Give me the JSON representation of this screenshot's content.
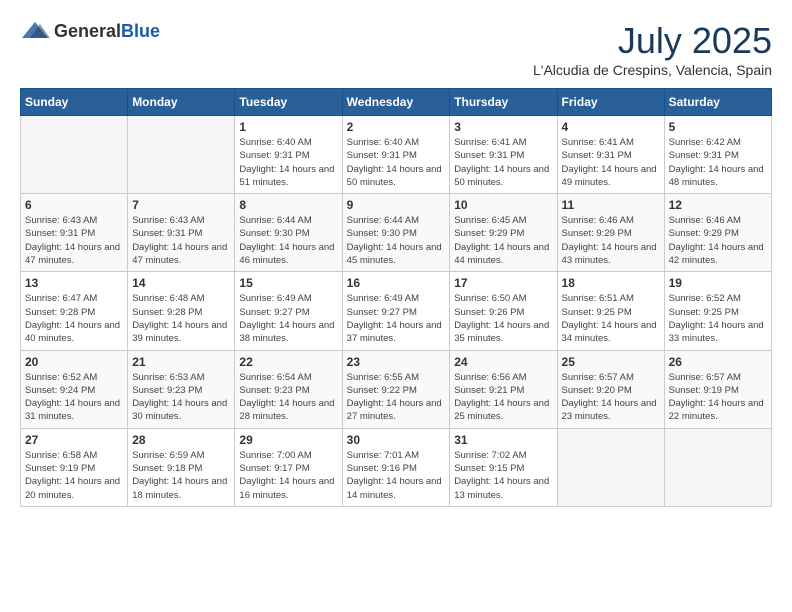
{
  "logo": {
    "general": "General",
    "blue": "Blue"
  },
  "header": {
    "month": "July 2025",
    "location": "L'Alcudia de Crespins, Valencia, Spain"
  },
  "weekdays": [
    "Sunday",
    "Monday",
    "Tuesday",
    "Wednesday",
    "Thursday",
    "Friday",
    "Saturday"
  ],
  "weeks": [
    [
      {
        "day": "",
        "sunrise": "",
        "sunset": "",
        "daylight": ""
      },
      {
        "day": "",
        "sunrise": "",
        "sunset": "",
        "daylight": ""
      },
      {
        "day": "1",
        "sunrise": "Sunrise: 6:40 AM",
        "sunset": "Sunset: 9:31 PM",
        "daylight": "Daylight: 14 hours and 51 minutes."
      },
      {
        "day": "2",
        "sunrise": "Sunrise: 6:40 AM",
        "sunset": "Sunset: 9:31 PM",
        "daylight": "Daylight: 14 hours and 50 minutes."
      },
      {
        "day": "3",
        "sunrise": "Sunrise: 6:41 AM",
        "sunset": "Sunset: 9:31 PM",
        "daylight": "Daylight: 14 hours and 50 minutes."
      },
      {
        "day": "4",
        "sunrise": "Sunrise: 6:41 AM",
        "sunset": "Sunset: 9:31 PM",
        "daylight": "Daylight: 14 hours and 49 minutes."
      },
      {
        "day": "5",
        "sunrise": "Sunrise: 6:42 AM",
        "sunset": "Sunset: 9:31 PM",
        "daylight": "Daylight: 14 hours and 48 minutes."
      }
    ],
    [
      {
        "day": "6",
        "sunrise": "Sunrise: 6:43 AM",
        "sunset": "Sunset: 9:31 PM",
        "daylight": "Daylight: 14 hours and 47 minutes."
      },
      {
        "day": "7",
        "sunrise": "Sunrise: 6:43 AM",
        "sunset": "Sunset: 9:31 PM",
        "daylight": "Daylight: 14 hours and 47 minutes."
      },
      {
        "day": "8",
        "sunrise": "Sunrise: 6:44 AM",
        "sunset": "Sunset: 9:30 PM",
        "daylight": "Daylight: 14 hours and 46 minutes."
      },
      {
        "day": "9",
        "sunrise": "Sunrise: 6:44 AM",
        "sunset": "Sunset: 9:30 PM",
        "daylight": "Daylight: 14 hours and 45 minutes."
      },
      {
        "day": "10",
        "sunrise": "Sunrise: 6:45 AM",
        "sunset": "Sunset: 9:29 PM",
        "daylight": "Daylight: 14 hours and 44 minutes."
      },
      {
        "day": "11",
        "sunrise": "Sunrise: 6:46 AM",
        "sunset": "Sunset: 9:29 PM",
        "daylight": "Daylight: 14 hours and 43 minutes."
      },
      {
        "day": "12",
        "sunrise": "Sunrise: 6:46 AM",
        "sunset": "Sunset: 9:29 PM",
        "daylight": "Daylight: 14 hours and 42 minutes."
      }
    ],
    [
      {
        "day": "13",
        "sunrise": "Sunrise: 6:47 AM",
        "sunset": "Sunset: 9:28 PM",
        "daylight": "Daylight: 14 hours and 40 minutes."
      },
      {
        "day": "14",
        "sunrise": "Sunrise: 6:48 AM",
        "sunset": "Sunset: 9:28 PM",
        "daylight": "Daylight: 14 hours and 39 minutes."
      },
      {
        "day": "15",
        "sunrise": "Sunrise: 6:49 AM",
        "sunset": "Sunset: 9:27 PM",
        "daylight": "Daylight: 14 hours and 38 minutes."
      },
      {
        "day": "16",
        "sunrise": "Sunrise: 6:49 AM",
        "sunset": "Sunset: 9:27 PM",
        "daylight": "Daylight: 14 hours and 37 minutes."
      },
      {
        "day": "17",
        "sunrise": "Sunrise: 6:50 AM",
        "sunset": "Sunset: 9:26 PM",
        "daylight": "Daylight: 14 hours and 35 minutes."
      },
      {
        "day": "18",
        "sunrise": "Sunrise: 6:51 AM",
        "sunset": "Sunset: 9:25 PM",
        "daylight": "Daylight: 14 hours and 34 minutes."
      },
      {
        "day": "19",
        "sunrise": "Sunrise: 6:52 AM",
        "sunset": "Sunset: 9:25 PM",
        "daylight": "Daylight: 14 hours and 33 minutes."
      }
    ],
    [
      {
        "day": "20",
        "sunrise": "Sunrise: 6:52 AM",
        "sunset": "Sunset: 9:24 PM",
        "daylight": "Daylight: 14 hours and 31 minutes."
      },
      {
        "day": "21",
        "sunrise": "Sunrise: 6:53 AM",
        "sunset": "Sunset: 9:23 PM",
        "daylight": "Daylight: 14 hours and 30 minutes."
      },
      {
        "day": "22",
        "sunrise": "Sunrise: 6:54 AM",
        "sunset": "Sunset: 9:23 PM",
        "daylight": "Daylight: 14 hours and 28 minutes."
      },
      {
        "day": "23",
        "sunrise": "Sunrise: 6:55 AM",
        "sunset": "Sunset: 9:22 PM",
        "daylight": "Daylight: 14 hours and 27 minutes."
      },
      {
        "day": "24",
        "sunrise": "Sunrise: 6:56 AM",
        "sunset": "Sunset: 9:21 PM",
        "daylight": "Daylight: 14 hours and 25 minutes."
      },
      {
        "day": "25",
        "sunrise": "Sunrise: 6:57 AM",
        "sunset": "Sunset: 9:20 PM",
        "daylight": "Daylight: 14 hours and 23 minutes."
      },
      {
        "day": "26",
        "sunrise": "Sunrise: 6:57 AM",
        "sunset": "Sunset: 9:19 PM",
        "daylight": "Daylight: 14 hours and 22 minutes."
      }
    ],
    [
      {
        "day": "27",
        "sunrise": "Sunrise: 6:58 AM",
        "sunset": "Sunset: 9:19 PM",
        "daylight": "Daylight: 14 hours and 20 minutes."
      },
      {
        "day": "28",
        "sunrise": "Sunrise: 6:59 AM",
        "sunset": "Sunset: 9:18 PM",
        "daylight": "Daylight: 14 hours and 18 minutes."
      },
      {
        "day": "29",
        "sunrise": "Sunrise: 7:00 AM",
        "sunset": "Sunset: 9:17 PM",
        "daylight": "Daylight: 14 hours and 16 minutes."
      },
      {
        "day": "30",
        "sunrise": "Sunrise: 7:01 AM",
        "sunset": "Sunset: 9:16 PM",
        "daylight": "Daylight: 14 hours and 14 minutes."
      },
      {
        "day": "31",
        "sunrise": "Sunrise: 7:02 AM",
        "sunset": "Sunset: 9:15 PM",
        "daylight": "Daylight: 14 hours and 13 minutes."
      },
      {
        "day": "",
        "sunrise": "",
        "sunset": "",
        "daylight": ""
      },
      {
        "day": "",
        "sunrise": "",
        "sunset": "",
        "daylight": ""
      }
    ]
  ]
}
